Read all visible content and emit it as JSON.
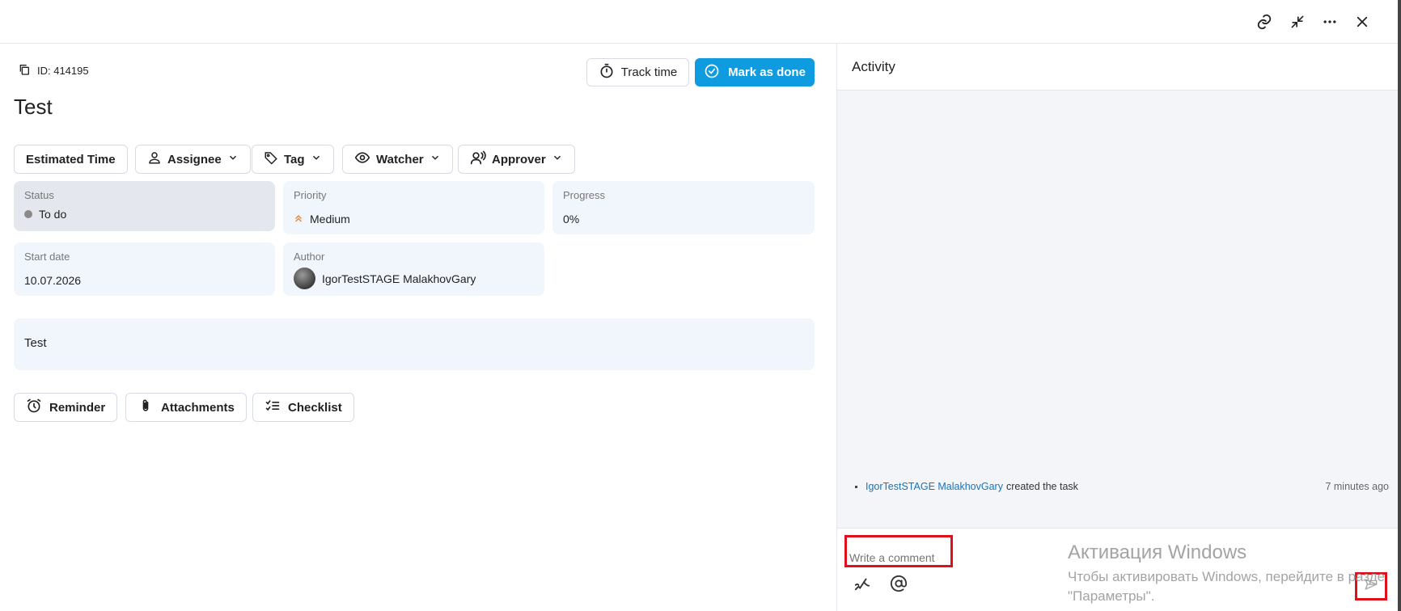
{
  "topbar": {
    "icons": [
      "link-icon",
      "collapse-icon",
      "more-icon",
      "close-icon"
    ]
  },
  "task": {
    "id_label": "ID: 414195",
    "title": "Test",
    "description": "Test"
  },
  "actions": {
    "track_time": "Track time",
    "mark_done": "Mark as done"
  },
  "chips": {
    "estimated_time": "Estimated Time",
    "assignee": "Assignee",
    "tag": "Tag",
    "watcher": "Watcher",
    "approver": "Approver"
  },
  "fields": {
    "status_label": "Status",
    "status_value": "To do",
    "priority_label": "Priority",
    "priority_value": "Medium",
    "progress_label": "Progress",
    "progress_value": "0%",
    "start_label": "Start date",
    "start_value": "10.07.2026",
    "author_label": "Author",
    "author_value": "IgorTestSTAGE MalakhovGary"
  },
  "bottom_buttons": {
    "reminder": "Reminder",
    "attachments": "Attachments",
    "checklist": "Checklist"
  },
  "activity": {
    "title": "Activity",
    "entry_user": "IgorTestSTAGE MalakhovGary",
    "entry_text": "created the task",
    "entry_time": "7 minutes ago"
  },
  "composer": {
    "placeholder": "Write a comment"
  },
  "watermark": {
    "line1": "Активация Windows",
    "line2": "Чтобы активировать Windows, перейдите в разде",
    "line3": "\"Параметры\"."
  },
  "colors": {
    "primary": "#0f9be0",
    "highlight": "#e0101a",
    "card_bg": "#f1f5fc",
    "status_card_bg": "#e5e7ef",
    "priority_icon": "#e8893a"
  }
}
